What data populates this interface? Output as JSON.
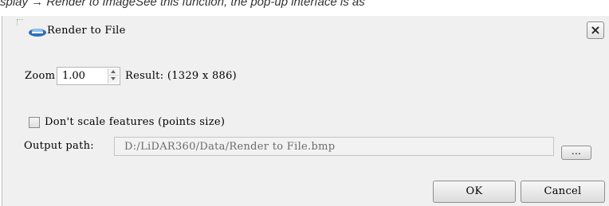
{
  "document": {
    "caption": "splay → Render to ImageSee this function, the pop-up interface is as"
  },
  "dialog": {
    "title": "Render to File",
    "close_label": "×",
    "zoom_label": "Zoom",
    "zoom_value": "1.00",
    "result_label": "Result: (1329 x 886)",
    "dont_scale_label": "Don't scale features (points size)",
    "dont_scale_checked": false,
    "output_path_label": "Output path:",
    "output_path_value": "D:/LiDAR360/Data/Render to File.bmp",
    "browse_label": "...",
    "ok_label": "OK",
    "cancel_label": "Cancel"
  },
  "icons": {
    "logo": "lidar360-logo-icon",
    "close": "close-icon",
    "spin_up": "arrow-up-icon",
    "spin_down": "arrow-down-icon"
  },
  "colors": {
    "dialog_background": "#f0f0f0",
    "logo_blue": "#2f6fb8"
  }
}
